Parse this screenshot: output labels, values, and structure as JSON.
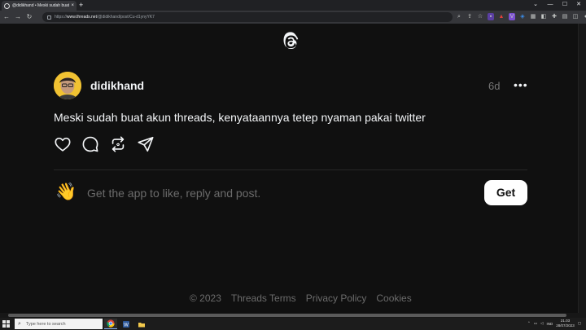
{
  "browser": {
    "tab_title": "@didikhand • Meski sudah buat akun threads, kenyataannya tetep nyaman pakai twitter",
    "tab_close": "×",
    "new_tab": "+",
    "url_prefix": "https://",
    "url_host": "www.threads.net",
    "url_path": "/@didikhand/post/Cu-d1ynyYK7",
    "win_minimize": "—",
    "win_maximize": "☐",
    "win_close": "✕",
    "nav_back": "←",
    "nav_forward": "→",
    "nav_reload": "↻"
  },
  "post": {
    "username": "didikhand",
    "time": "6d",
    "more": "•••",
    "text": "Meski sudah buat akun threads, kenyataannya tetep nyaman pakai twitter"
  },
  "cta": {
    "emoji": "👋",
    "text": "Get the app to like, reply and post.",
    "button": "Get"
  },
  "footer": {
    "copyright": "© 2023",
    "terms": "Threads Terms",
    "privacy": "Privacy Policy",
    "cookies": "Cookies"
  },
  "taskbar": {
    "search_placeholder": "Type here to search",
    "language": "IND",
    "time": "21.03",
    "date": "28/07/2023"
  },
  "icons": {
    "like": "heart-icon",
    "reply": "comment-icon",
    "repost": "repost-icon",
    "share": "send-icon"
  },
  "colors": {
    "background": "#101010",
    "text": "#f3f5f7",
    "muted": "#6b6b6b",
    "button_bg": "#ffffff",
    "avatar_bg": "#f1c232"
  }
}
